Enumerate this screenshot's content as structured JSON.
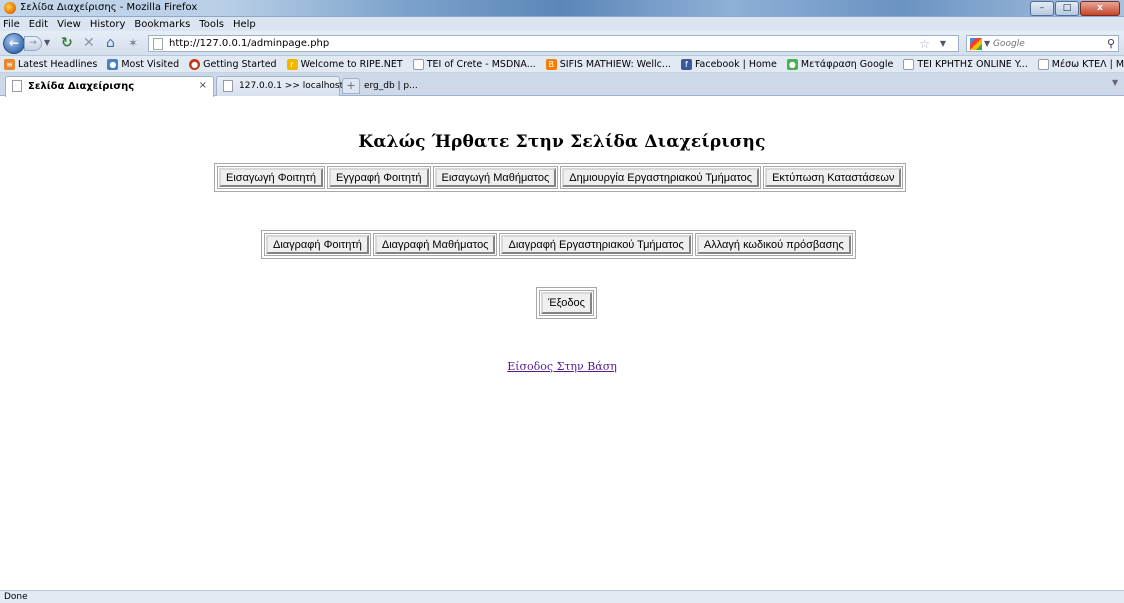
{
  "window": {
    "title": "Σελίδα Διαχείρισης - Mozilla Firefox",
    "controls": [
      "–",
      "□",
      "x"
    ]
  },
  "menu": [
    "File",
    "Edit",
    "View",
    "History",
    "Bookmarks",
    "Tools",
    "Help"
  ],
  "navigation": {
    "url": "http://127.0.0.1/adminpage.php",
    "search_placeholder": "Google"
  },
  "bookmarks": [
    {
      "label": "Latest Headlines",
      "icon": "rss-icon",
      "color": "#e8882e"
    },
    {
      "label": "Most Visited",
      "icon": "most-visited-icon",
      "color": "#4a7fc1"
    },
    {
      "label": "Getting Started",
      "icon": "firefox-icon",
      "color": "#c0391b"
    },
    {
      "label": "Welcome to RIPE.NET",
      "icon": "ripe-icon",
      "color": "#f2b705"
    },
    {
      "label": "TEI of Crete - MSDNA...",
      "icon": "page-icon",
      "color": "#ffffff"
    },
    {
      "label": "SIFIS MATHIEW: Wellc...",
      "icon": "blogger-icon",
      "color": "#f57d00"
    },
    {
      "label": "Facebook | Home",
      "icon": "facebook-icon",
      "color": "#3b5998"
    },
    {
      "label": "Μετάφραση Google",
      "icon": "google-translate-icon",
      "color": "#4caf50"
    },
    {
      "label": "TEI ΚΡΗΤΗΣ ONLINE Y...",
      "icon": "page-icon",
      "color": "#ffffff"
    },
    {
      "label": "Μέσω ΚΤΕΛ | Μέσω Κ...",
      "icon": "page-icon",
      "color": "#ffffff"
    }
  ],
  "tabs": [
    {
      "label": "Σελίδα Διαχείρισης",
      "close": "×",
      "active": true
    },
    {
      "label": "127.0.0.1 >> localhost >> erg_db | p...",
      "close": "×",
      "active": false
    }
  ],
  "new_tab": "+",
  "page": {
    "title": "Καλώς Ήρθατε Στην Σελίδα Διαχείρισης",
    "row1_buttons": [
      "Εισαγωγή Φοιτητή",
      "Εγγραφή Φοιτητή",
      "Εισαγωγή Μαθήματος",
      "Δημιουργία Εργαστηριακού Τμήματος",
      "Εκτύπωση Καταστάσεων"
    ],
    "row2_buttons": [
      "Διαγραφή Φοιτητή",
      "Διαγραφή  Μαθήματος",
      "Διαγραφή Εργαστηριακού Τμήματος",
      "Αλλαγή κωδικού πρόσβασης"
    ],
    "exit_button": "Έξοδος",
    "db_link": "Είσοδος Στην Βάση"
  },
  "status": "Done"
}
